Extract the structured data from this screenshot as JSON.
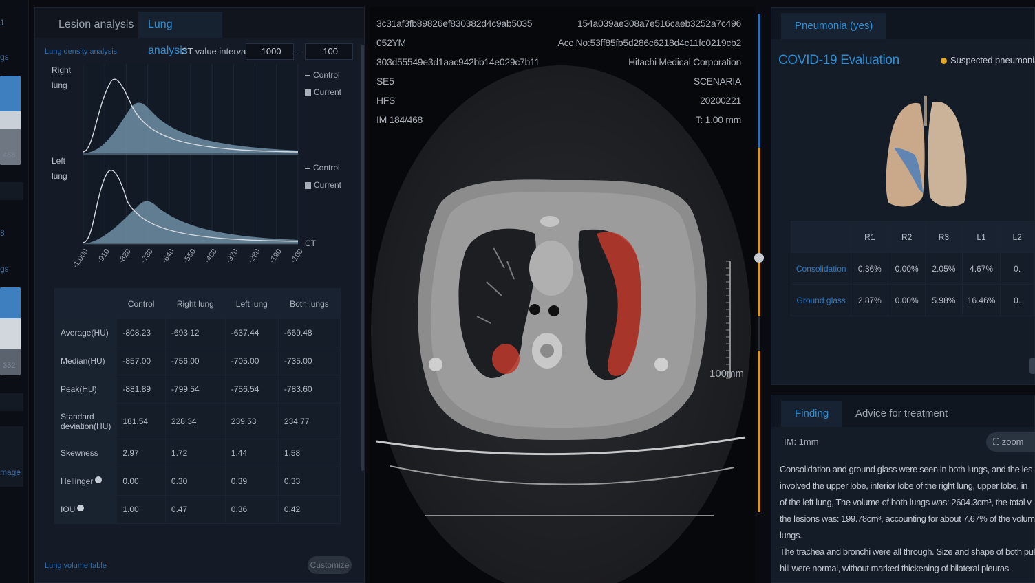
{
  "strip": {
    "label_a": "1",
    "label_b": "gs",
    "count_a": "468",
    "label_c": "8",
    "label_d": "gs",
    "count_b": "352",
    "label_e": "mage"
  },
  "left_panel": {
    "tabs": [
      "Lesion analysis",
      "Lung analysis"
    ],
    "active_tab": "Lung analysis",
    "section_label": "Lung density analysis",
    "ct_interval_label": "CT value interval:",
    "ct_min": "-1000",
    "ct_max": "-100",
    "dash": "–",
    "right_lung_label": "Right lung",
    "left_lung_label": "Left lung",
    "legend_control": "Control",
    "legend_current": "Current",
    "x_axis_unit": "CT",
    "x_ticks": [
      "-1,000",
      "-910",
      "-820",
      "-730",
      "-640",
      "-550",
      "-460",
      "-370",
      "-280",
      "-190",
      "-100"
    ],
    "table_headers": [
      "",
      "Control",
      "Right lung",
      "Left lung",
      "Both lungs"
    ],
    "table_rows": [
      {
        "label": "Average(HU)",
        "values": [
          "-808.23",
          "-693.12",
          "-637.44",
          "-669.48"
        ]
      },
      {
        "label": "Median(HU)",
        "values": [
          "-857.00",
          "-756.00",
          "-705.00",
          "-735.00"
        ]
      },
      {
        "label": "Peak(HU)",
        "values": [
          "-881.89",
          "-799.54",
          "-756.54",
          "-783.60"
        ]
      },
      {
        "label": "Standard deviation(HU)",
        "values": [
          "181.54",
          "228.34",
          "239.53",
          "234.77"
        ]
      },
      {
        "label": "Skewness",
        "values": [
          "2.97",
          "1.72",
          "1.44",
          "1.58"
        ]
      },
      {
        "label": "Hellinger",
        "values": [
          "0.00",
          "0.30",
          "0.39",
          "0.33"
        ]
      },
      {
        "label": "IOU",
        "values": [
          "1.00",
          "0.47",
          "0.36",
          "0.42"
        ]
      }
    ],
    "volume_table_label": "Lung volume table",
    "customize_button": "Customize"
  },
  "viewer": {
    "left_lines": [
      "3c31af3fb89826ef830382d4c9ab5035",
      "052YM",
      "303d55549e3d1aac942bb14e029c7b11",
      "SE5",
      "HFS",
      "IM 184/468"
    ],
    "right_lines": [
      "154a039ae308a7e516caeb3252a7c496",
      "Acc No:53ff85fb5d286c6218d4c11fc0219cb2",
      "Hitachi Medical Corporation",
      "SCENARIA",
      "20200221",
      "T: 1.00 mm"
    ],
    "scale_label": "100mm"
  },
  "right_panel": {
    "tab": "Pneumonia (yes)",
    "title": "COVID-19 Evaluation",
    "status": "Suspected pneumonia",
    "region_headers": [
      "R1",
      "R2",
      "R3",
      "L1",
      "L2"
    ],
    "region_rows": [
      {
        "label": "Consolidation",
        "values": [
          "0.36%",
          "0.00%",
          "2.05%",
          "4.67%",
          "0."
        ]
      },
      {
        "label": "Ground glass",
        "values": [
          "2.87%",
          "0.00%",
          "5.98%",
          "16.46%",
          "0."
        ]
      }
    ],
    "bottom_tabs": [
      "Finding",
      "Advice for treatment"
    ],
    "im_label": "IM:  1mm",
    "zoom_label": "zoom",
    "finding_lines": [
      "Consolidation and ground glass were seen in both lungs,  and the les",
      "involved the upper lobe, inferior lobe of the right lung, upper lobe, in",
      "of the left lung, The volume of both lungs was: 2604.3cm³, the total v",
      "the lesions was: 199.78cm³,  accounting for about 7.67% of the volum",
      "lungs.",
      "The trachea and bronchi were all through. Size and shape of both pul",
      "hili were normal, without marked thickening of bilateral pleuras."
    ]
  },
  "colors": {
    "accent": "#2c8fd6",
    "lesion": "#d63a2a",
    "status_dot": "#e3a62a",
    "slider": "#d99a1c"
  },
  "chart_data": [
    {
      "type": "area",
      "title": "",
      "series_label": "Right lung",
      "legend": [
        "Control",
        "Current"
      ],
      "x": [
        -1000,
        -910,
        -820,
        -730,
        -640,
        -550,
        -460,
        -370,
        -280,
        -190,
        -100
      ],
      "xlabel": "CT"
    },
    {
      "type": "area",
      "title": "",
      "series_label": "Left lung",
      "legend": [
        "Control",
        "Current"
      ],
      "x": [
        -1000,
        -910,
        -820,
        -730,
        -640,
        -550,
        -460,
        -370,
        -280,
        -190,
        -100
      ],
      "xlabel": "CT"
    }
  ]
}
